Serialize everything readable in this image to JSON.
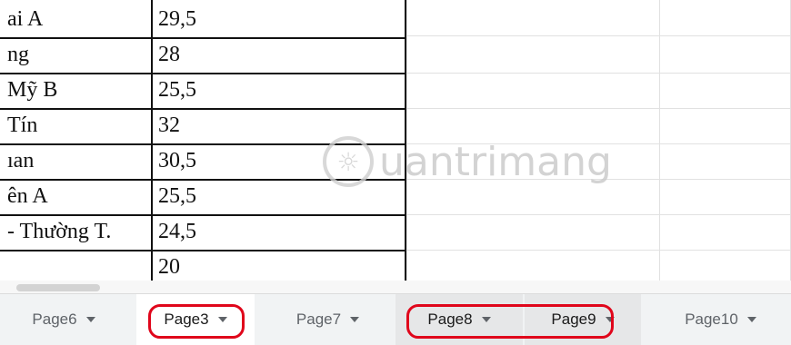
{
  "sheet": {
    "rows": [
      {
        "name": "ai A",
        "score": "29,5"
      },
      {
        "name": "ng",
        "score": "28"
      },
      {
        "name": "Mỹ B",
        "score": "25,5"
      },
      {
        "name": "Tín",
        "score": "32"
      },
      {
        "name": "ıan",
        "score": "30,5"
      },
      {
        "name": "ên A",
        "score": "25,5"
      },
      {
        "name": "- Thường T.",
        "score": "24,5"
      },
      {
        "name": "",
        "score": "20"
      }
    ]
  },
  "watermark": {
    "text": "uantrimang"
  },
  "tabs": [
    {
      "label": "Page6"
    },
    {
      "label": "Page3"
    },
    {
      "label": "Page7"
    },
    {
      "label": "Page8"
    },
    {
      "label": "Page9"
    },
    {
      "label": "Page10"
    }
  ],
  "colors": {
    "highlight": "#e0061b",
    "tabbar": "#f1f3f4",
    "active_tab": "#ffffff"
  },
  "icons": {
    "tab_menu": "caret-down-icon"
  }
}
